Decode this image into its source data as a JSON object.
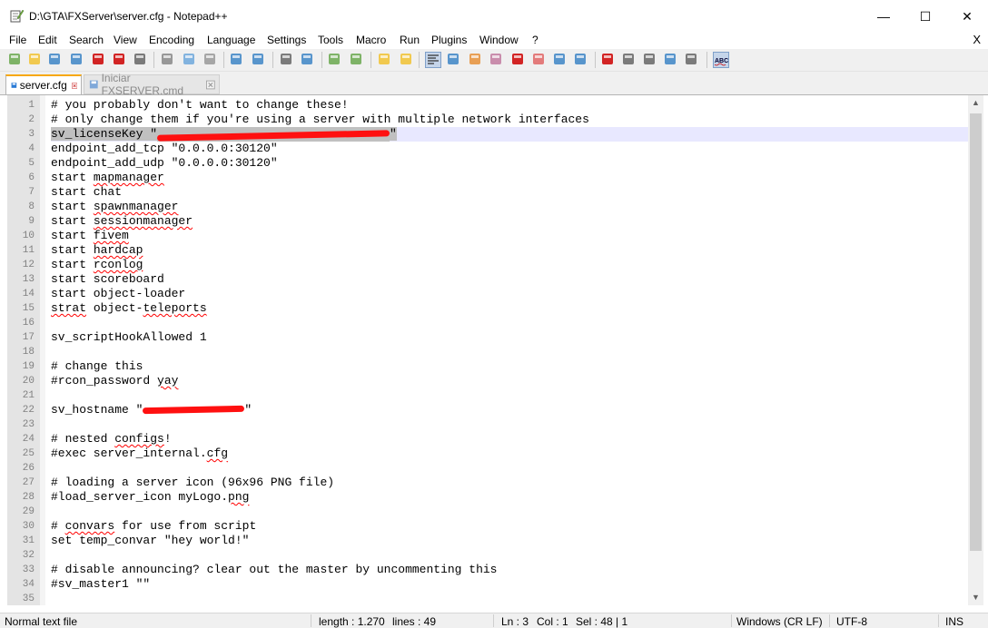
{
  "window": {
    "title": "D:\\GTA\\FXServer\\server.cfg - Notepad++",
    "minimize": "—",
    "maximize": "☐",
    "close": "✕"
  },
  "menu": [
    "File",
    "Edit",
    "Search",
    "View",
    "Encoding",
    "Language",
    "Settings",
    "Tools",
    "Macro",
    "Run",
    "Plugins",
    "Window",
    "?"
  ],
  "menu_close": "X",
  "toolbar_icons": [
    "new-file-icon",
    "open-file-icon",
    "save-icon",
    "save-all-icon",
    "close-icon",
    "close-all-icon",
    "print-icon",
    "cut-icon",
    "copy-icon",
    "paste-icon",
    "undo-icon",
    "redo-icon",
    "find-icon",
    "replace-icon",
    "zoom-in-icon",
    "zoom-out-icon",
    "sync-vertical-icon",
    "sync-horizontal-icon",
    "word-wrap-icon",
    "show-all-chars-icon",
    "indent-guide-icon",
    "user-defined-language-icon",
    "document-map-icon",
    "function-list-icon",
    "folder-as-workspace-icon",
    "monitoring-icon",
    "record-macro-icon",
    "stop-record-icon",
    "playback-macro-icon",
    "run-macro-multiple-icon",
    "save-macro-icon",
    "spell-check-icon"
  ],
  "tabs": [
    {
      "label": "server.cfg",
      "active": true
    },
    {
      "label": "Iniciar FXSERVER.cmd",
      "active": false
    }
  ],
  "lines": [
    {
      "n": "1",
      "segs": [
        {
          "t": "# you probably don't want to change these!"
        }
      ]
    },
    {
      "n": "2",
      "segs": [
        {
          "t": "# only change them if you're using a server with multiple network interfaces"
        }
      ]
    },
    {
      "n": "3",
      "current": true,
      "segs": [
        {
          "t": "sv_licenseKey \"",
          "sel": true
        },
        {
          "redact": 32,
          "sel": true
        },
        {
          "t": "\"",
          "sel": true
        }
      ]
    },
    {
      "n": "4",
      "segs": [
        {
          "t": "endpoint_add_tcp \"0.0.0.0:30120\""
        }
      ]
    },
    {
      "n": "5",
      "segs": [
        {
          "t": "endpoint_add_udp \"0.0.0.0:30120\""
        }
      ]
    },
    {
      "n": "6",
      "segs": [
        {
          "t": "start "
        },
        {
          "t": "mapmanager",
          "sq": true
        }
      ]
    },
    {
      "n": "7",
      "segs": [
        {
          "t": "start chat"
        }
      ]
    },
    {
      "n": "8",
      "segs": [
        {
          "t": "start "
        },
        {
          "t": "spawnmanager",
          "sq": true
        }
      ]
    },
    {
      "n": "9",
      "segs": [
        {
          "t": "start "
        },
        {
          "t": "sessionmanager",
          "sq": true
        }
      ]
    },
    {
      "n": "10",
      "segs": [
        {
          "t": "start "
        },
        {
          "t": "fivem",
          "sq": true
        }
      ]
    },
    {
      "n": "11",
      "segs": [
        {
          "t": "start "
        },
        {
          "t": "hardcap",
          "sq": true
        }
      ]
    },
    {
      "n": "12",
      "segs": [
        {
          "t": "start "
        },
        {
          "t": "rconlog",
          "sq": true
        }
      ]
    },
    {
      "n": "13",
      "segs": [
        {
          "t": "start scoreboard"
        }
      ]
    },
    {
      "n": "14",
      "segs": [
        {
          "t": "start object-loader"
        }
      ]
    },
    {
      "n": "15",
      "segs": [
        {
          "t": "strat",
          "sq": true
        },
        {
          "t": " object-"
        },
        {
          "t": "teleports",
          "sq": true
        }
      ]
    },
    {
      "n": "16",
      "segs": []
    },
    {
      "n": "17",
      "segs": [
        {
          "t": "sv_scriptHookAllowed 1"
        }
      ]
    },
    {
      "n": "18",
      "segs": []
    },
    {
      "n": "19",
      "segs": [
        {
          "t": "# change this"
        }
      ]
    },
    {
      "n": "20",
      "segs": [
        {
          "t": "#rcon_password "
        },
        {
          "t": "yay",
          "sq": true
        }
      ]
    },
    {
      "n": "21",
      "segs": []
    },
    {
      "n": "22",
      "segs": [
        {
          "t": "sv_hostname \""
        },
        {
          "redact": 14
        },
        {
          "t": "\""
        }
      ]
    },
    {
      "n": "23",
      "segs": []
    },
    {
      "n": "24",
      "segs": [
        {
          "t": "# nested "
        },
        {
          "t": "configs",
          "sq": true
        },
        {
          "t": "!"
        }
      ]
    },
    {
      "n": "25",
      "segs": [
        {
          "t": "#exec server_internal."
        },
        {
          "t": "cfg",
          "sq": true
        }
      ]
    },
    {
      "n": "26",
      "segs": []
    },
    {
      "n": "27",
      "segs": [
        {
          "t": "# loading a server icon (96x96 PNG file)"
        }
      ]
    },
    {
      "n": "28",
      "segs": [
        {
          "t": "#load_server_icon myLogo."
        },
        {
          "t": "png",
          "sq": true
        }
      ]
    },
    {
      "n": "29",
      "segs": []
    },
    {
      "n": "30",
      "segs": [
        {
          "t": "# "
        },
        {
          "t": "convars",
          "sq": true
        },
        {
          "t": " for use from script"
        }
      ]
    },
    {
      "n": "31",
      "segs": [
        {
          "t": "set temp_convar \"hey world!\""
        }
      ]
    },
    {
      "n": "32",
      "segs": []
    },
    {
      "n": "33",
      "segs": [
        {
          "t": "# disable announcing? clear out the master by uncommenting this"
        }
      ]
    },
    {
      "n": "34",
      "segs": [
        {
          "t": "#sv_master1 \"\""
        }
      ]
    },
    {
      "n": "35",
      "segs": []
    }
  ],
  "status": {
    "file_type": "Normal text file",
    "length": "length : 1.270",
    "lines": "lines : 49",
    "ln": "Ln : 3",
    "col": "Col : 1",
    "sel": "Sel : 48 | 1",
    "eol": "Windows (CR LF)",
    "encoding": "UTF-8",
    "mode": "INS"
  },
  "colors": {
    "tab_accent": "#f7a80c",
    "current_line": "#e8e8ff",
    "redaction": "#ff1010",
    "spellcheck": "#ff0000"
  }
}
